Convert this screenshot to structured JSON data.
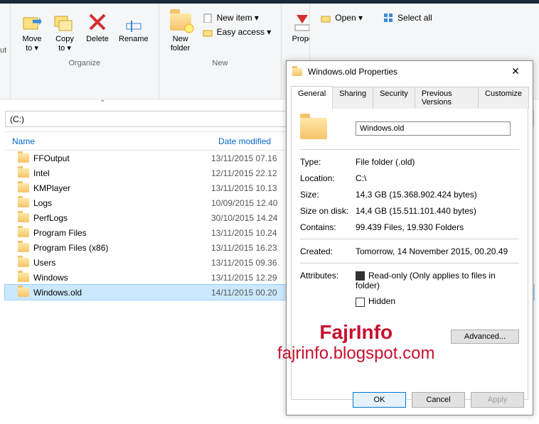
{
  "ribbon": {
    "partial_left": "ut",
    "move_to": "Move\nto ▾",
    "copy_to": "Copy\nto ▾",
    "delete": "Delete",
    "rename": "Rename",
    "new_folder": "New\nfolder",
    "new_item": "New item ▾",
    "easy_access": "Easy access ▾",
    "properties": "Prope",
    "open": "Open ▾",
    "select_all": "Select all",
    "grp_organize": "Organize",
    "grp_new": "New"
  },
  "address": "(C:)",
  "columns": {
    "name": "Name",
    "date": "Date modified"
  },
  "rows": [
    {
      "name": "FFOutput",
      "date": "13/11/2015 07.16"
    },
    {
      "name": "Intel",
      "date": "12/11/2015 22.12"
    },
    {
      "name": "KMPlayer",
      "date": "13/11/2015 10.13"
    },
    {
      "name": "Logs",
      "date": "10/09/2015 12.40"
    },
    {
      "name": "PerfLogs",
      "date": "30/10/2015 14.24"
    },
    {
      "name": "Program Files",
      "date": "13/11/2015 10.24"
    },
    {
      "name": "Program Files (x86)",
      "date": "13/11/2015 16.23"
    },
    {
      "name": "Users",
      "date": "13/11/2015 09.36"
    },
    {
      "name": "Windows",
      "date": "13/11/2015 12.29"
    },
    {
      "name": "Windows.old",
      "date": "14/11/2015 00.20",
      "sel": true
    }
  ],
  "props": {
    "title": "Windows.old Properties",
    "tabs": [
      "General",
      "Sharing",
      "Security",
      "Previous Versions",
      "Customize"
    ],
    "name": "Windows.old",
    "type_k": "Type:",
    "type_v": "File folder (.old)",
    "loc_k": "Location:",
    "loc_v": "C:\\",
    "size_k": "Size:",
    "size_v": "14,3 GB (15.368.902.424 bytes)",
    "sod_k": "Size on disk:",
    "sod_v": "14,4 GB (15.511.101.440 bytes)",
    "cont_k": "Contains:",
    "cont_v": "99.439 Files, 19.930 Folders",
    "created_k": "Created:",
    "created_v": "Tomorrow, 14 November 2015, 00.20.49",
    "attr_k": "Attributes:",
    "readonly": "Read-only (Only applies to files in folder)",
    "hidden": "Hidden",
    "advanced": "Advanced...",
    "ok": "OK",
    "cancel": "Cancel",
    "apply": "Apply"
  },
  "watermark": {
    "l1": "FajrInfo",
    "l2": "fajrinfo.blogspot.com"
  }
}
